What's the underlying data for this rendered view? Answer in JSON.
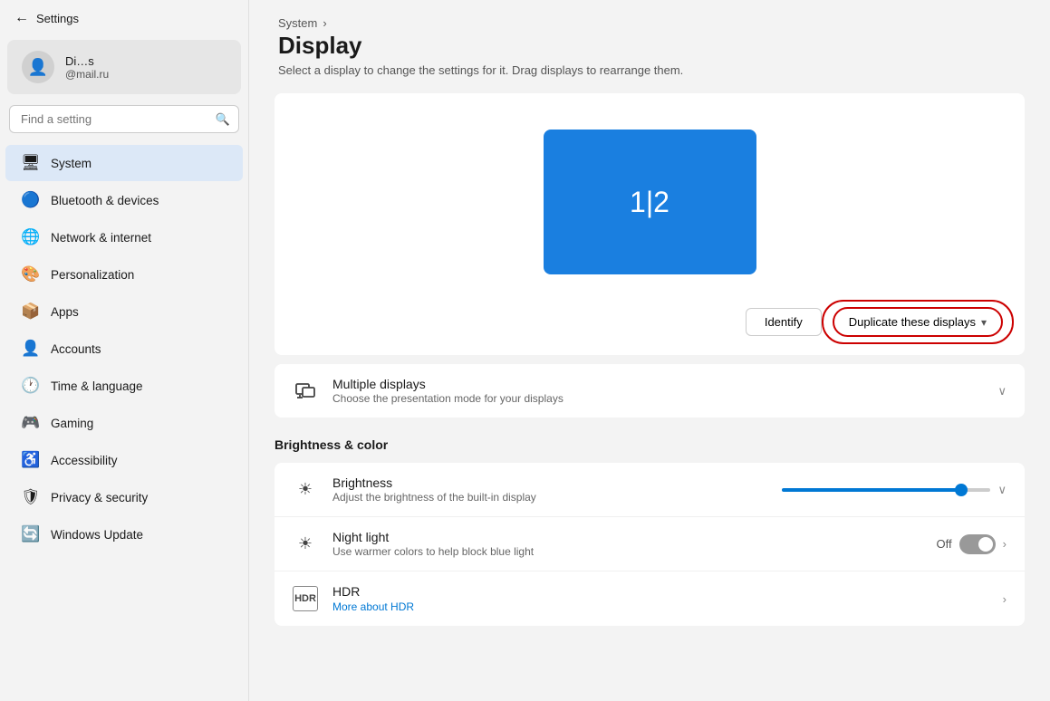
{
  "window": {
    "title": "Settings"
  },
  "sidebar": {
    "back_label": "←",
    "title": "Settings",
    "user": {
      "name": "Di…s",
      "email": "@mail.ru"
    },
    "search_placeholder": "Find a setting",
    "nav_items": [
      {
        "id": "system",
        "label": "System",
        "icon": "🖥",
        "active": true
      },
      {
        "id": "bluetooth",
        "label": "Bluetooth & devices",
        "icon": "🔵",
        "active": false
      },
      {
        "id": "network",
        "label": "Network & internet",
        "icon": "🌐",
        "active": false
      },
      {
        "id": "personalization",
        "label": "Personalization",
        "icon": "🎨",
        "active": false
      },
      {
        "id": "apps",
        "label": "Apps",
        "icon": "📦",
        "active": false
      },
      {
        "id": "accounts",
        "label": "Accounts",
        "icon": "👤",
        "active": false
      },
      {
        "id": "time-language",
        "label": "Time & language",
        "icon": "🕐",
        "active": false
      },
      {
        "id": "gaming",
        "label": "Gaming",
        "icon": "🎮",
        "active": false
      },
      {
        "id": "accessibility",
        "label": "Accessibility",
        "icon": "♿",
        "active": false
      },
      {
        "id": "privacy",
        "label": "Privacy & security",
        "icon": "🛡",
        "active": false
      },
      {
        "id": "windows-update",
        "label": "Windows Update",
        "icon": "🔄",
        "active": false
      }
    ]
  },
  "main": {
    "breadcrumb_parent": "System",
    "breadcrumb_sep": "›",
    "page_title": "Display",
    "page_subtitle": "Select a display to change the settings for it. Drag displays to rearrange them.",
    "display_monitor_label": "1|2",
    "identify_btn": "Identify",
    "duplicate_btn": "Duplicate these displays",
    "multiple_displays": {
      "label": "Multiple displays",
      "desc": "Choose the presentation mode for your displays"
    },
    "brightness_color_title": "Brightness & color",
    "brightness": {
      "label": "Brightness",
      "desc": "Adjust the brightness of the built-in display",
      "value": 88
    },
    "night_light": {
      "label": "Night light",
      "desc": "Use warmer colors to help block blue light",
      "status": "Off",
      "enabled": false
    },
    "hdr": {
      "label": "HDR",
      "link_text": "More about HDR"
    }
  }
}
